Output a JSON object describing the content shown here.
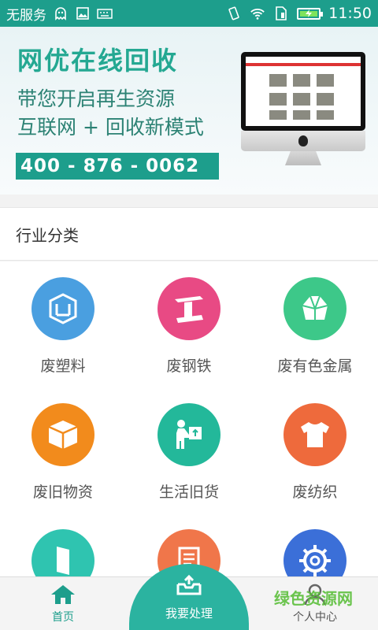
{
  "status_bar": {
    "carrier": "无服务",
    "time": "11:50",
    "icons": [
      "ghost-icon",
      "image-icon",
      "keyboard-icon",
      "vibrate-icon",
      "wifi-icon",
      "sim-icon",
      "battery-charging-icon"
    ]
  },
  "banner": {
    "title": "网优在线回收",
    "line1": "带您开启再生资源",
    "line2": "互联网 + 回收新模式",
    "phone": "400 - 876 - 0062"
  },
  "section": {
    "title": "行业分类"
  },
  "categories": [
    {
      "label": "废塑料",
      "color": "#4a9fe0",
      "icon": "plastic-icon"
    },
    {
      "label": "废钢铁",
      "color": "#e84a84",
      "icon": "steel-beam-icon"
    },
    {
      "label": "废有色金属",
      "color": "#3dc889",
      "icon": "crystal-icon"
    },
    {
      "label": "废旧物资",
      "color": "#f28b1c",
      "icon": "box-icon"
    },
    {
      "label": "生活旧货",
      "color": "#23b89a",
      "icon": "person-carry-icon"
    },
    {
      "label": "废纺织",
      "color": "#ee6a3c",
      "icon": "tshirt-icon"
    },
    {
      "label": "",
      "color": "#2fc4b0",
      "icon": "door-icon"
    },
    {
      "label": "",
      "color": "#f0764a",
      "icon": "paper-icon"
    },
    {
      "label": "",
      "color": "#3b6fd8",
      "icon": "gear-icon"
    }
  ],
  "nav": {
    "home": "首页",
    "center": "我要处理",
    "profile": "个人中心"
  },
  "watermark": "绿色资源网",
  "colors": {
    "brand": "#1d9e8c",
    "accent": "#2bb3a0"
  }
}
